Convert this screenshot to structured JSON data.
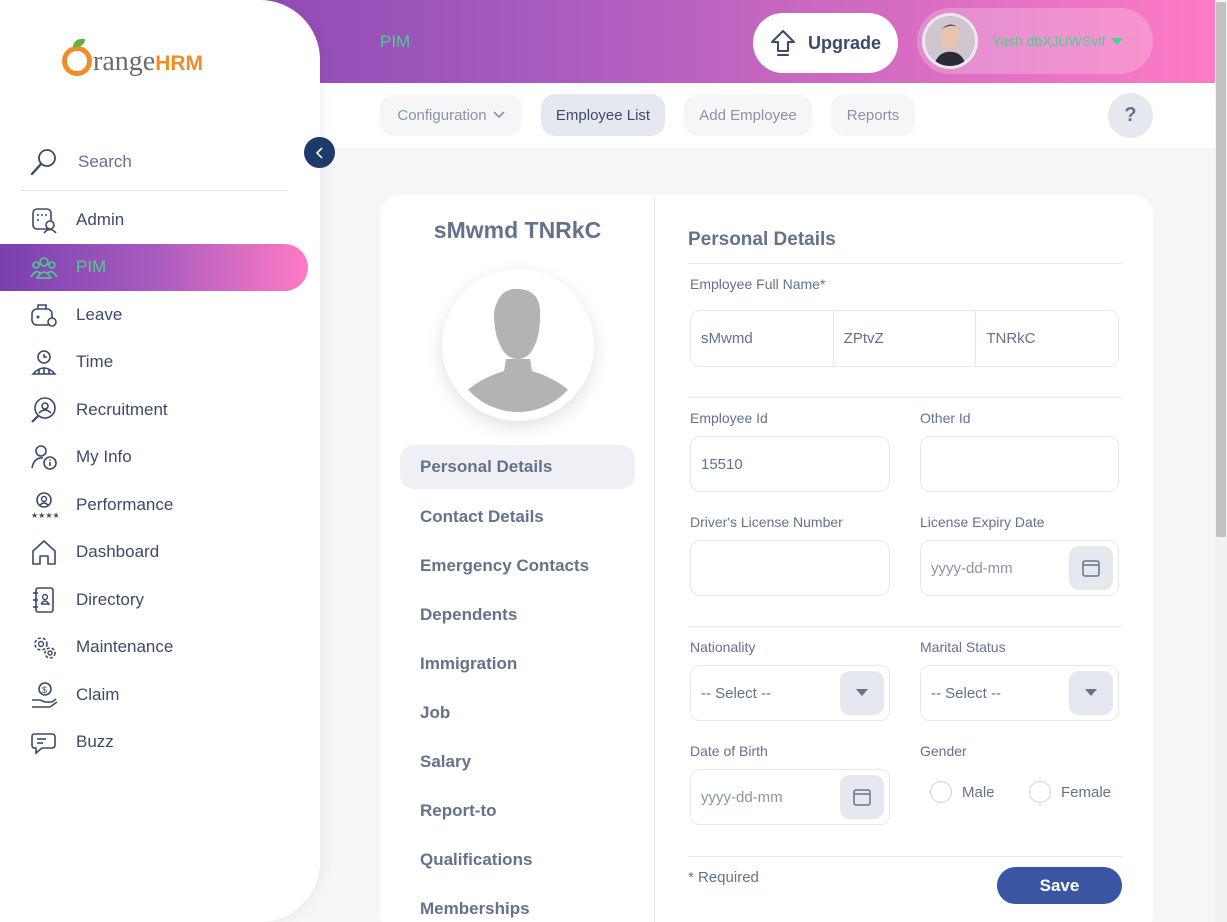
{
  "header": {
    "module_title": "PIM",
    "upgrade_label": "Upgrade",
    "user_name": "Yash dbXJUWSvlf"
  },
  "subnav": {
    "items": [
      {
        "label": "Configuration",
        "has_caret": true
      },
      {
        "label": "Employee List",
        "active": true
      },
      {
        "label": "Add Employee"
      },
      {
        "label": "Reports"
      }
    ],
    "help_label": "?"
  },
  "sidebar": {
    "logo": {
      "o": "",
      "rest": "range",
      "hrm": "HRM"
    },
    "search_label": "Search",
    "items": [
      {
        "label": "Admin",
        "icon": "admin-icon"
      },
      {
        "label": "PIM",
        "icon": "pim-icon",
        "active": true
      },
      {
        "label": "Leave",
        "icon": "leave-icon"
      },
      {
        "label": "Time",
        "icon": "time-icon"
      },
      {
        "label": "Recruitment",
        "icon": "recruitment-icon"
      },
      {
        "label": "My Info",
        "icon": "my-info-icon"
      },
      {
        "label": "Performance",
        "icon": "performance-icon"
      },
      {
        "label": "Dashboard",
        "icon": "dashboard-icon"
      },
      {
        "label": "Directory",
        "icon": "directory-icon"
      },
      {
        "label": "Maintenance",
        "icon": "maintenance-icon"
      },
      {
        "label": "Claim",
        "icon": "claim-icon"
      },
      {
        "label": "Buzz",
        "icon": "buzz-icon"
      }
    ]
  },
  "employee": {
    "name": "sMwmd TNRkC",
    "tabs": [
      {
        "label": "Personal Details",
        "active": true
      },
      {
        "label": "Contact Details"
      },
      {
        "label": "Emergency Contacts"
      },
      {
        "label": "Dependents"
      },
      {
        "label": "Immigration"
      },
      {
        "label": "Job"
      },
      {
        "label": "Salary"
      },
      {
        "label": "Report-to"
      },
      {
        "label": "Qualifications"
      },
      {
        "label": "Memberships"
      }
    ]
  },
  "form": {
    "title": "Personal Details",
    "full_name_label": "Employee Full Name*",
    "first_name": "sMwmd",
    "middle_name": "ZPtvZ",
    "last_name": "TNRkC",
    "employee_id_label": "Employee Id",
    "employee_id": "15510",
    "other_id_label": "Other Id",
    "other_id": "",
    "license_label": "Driver's License Number",
    "license_value": "",
    "license_expiry_label": "License Expiry Date",
    "license_expiry_placeholder": "yyyy-dd-mm",
    "nationality_label": "Nationality",
    "nationality_value": "-- Select --",
    "marital_label": "Marital Status",
    "marital_value": "-- Select --",
    "dob_label": "Date of Birth",
    "dob_placeholder": "yyyy-dd-mm",
    "gender_label": "Gender",
    "gender_options": [
      "Male",
      "Female"
    ],
    "required_note": "* Required",
    "save_label": "Save"
  },
  "colors": {
    "accent_green": "#48d18a",
    "gradient_start": "#7b3fb0",
    "gradient_end": "#ff7bc4",
    "save_blue": "#3a56a2"
  }
}
